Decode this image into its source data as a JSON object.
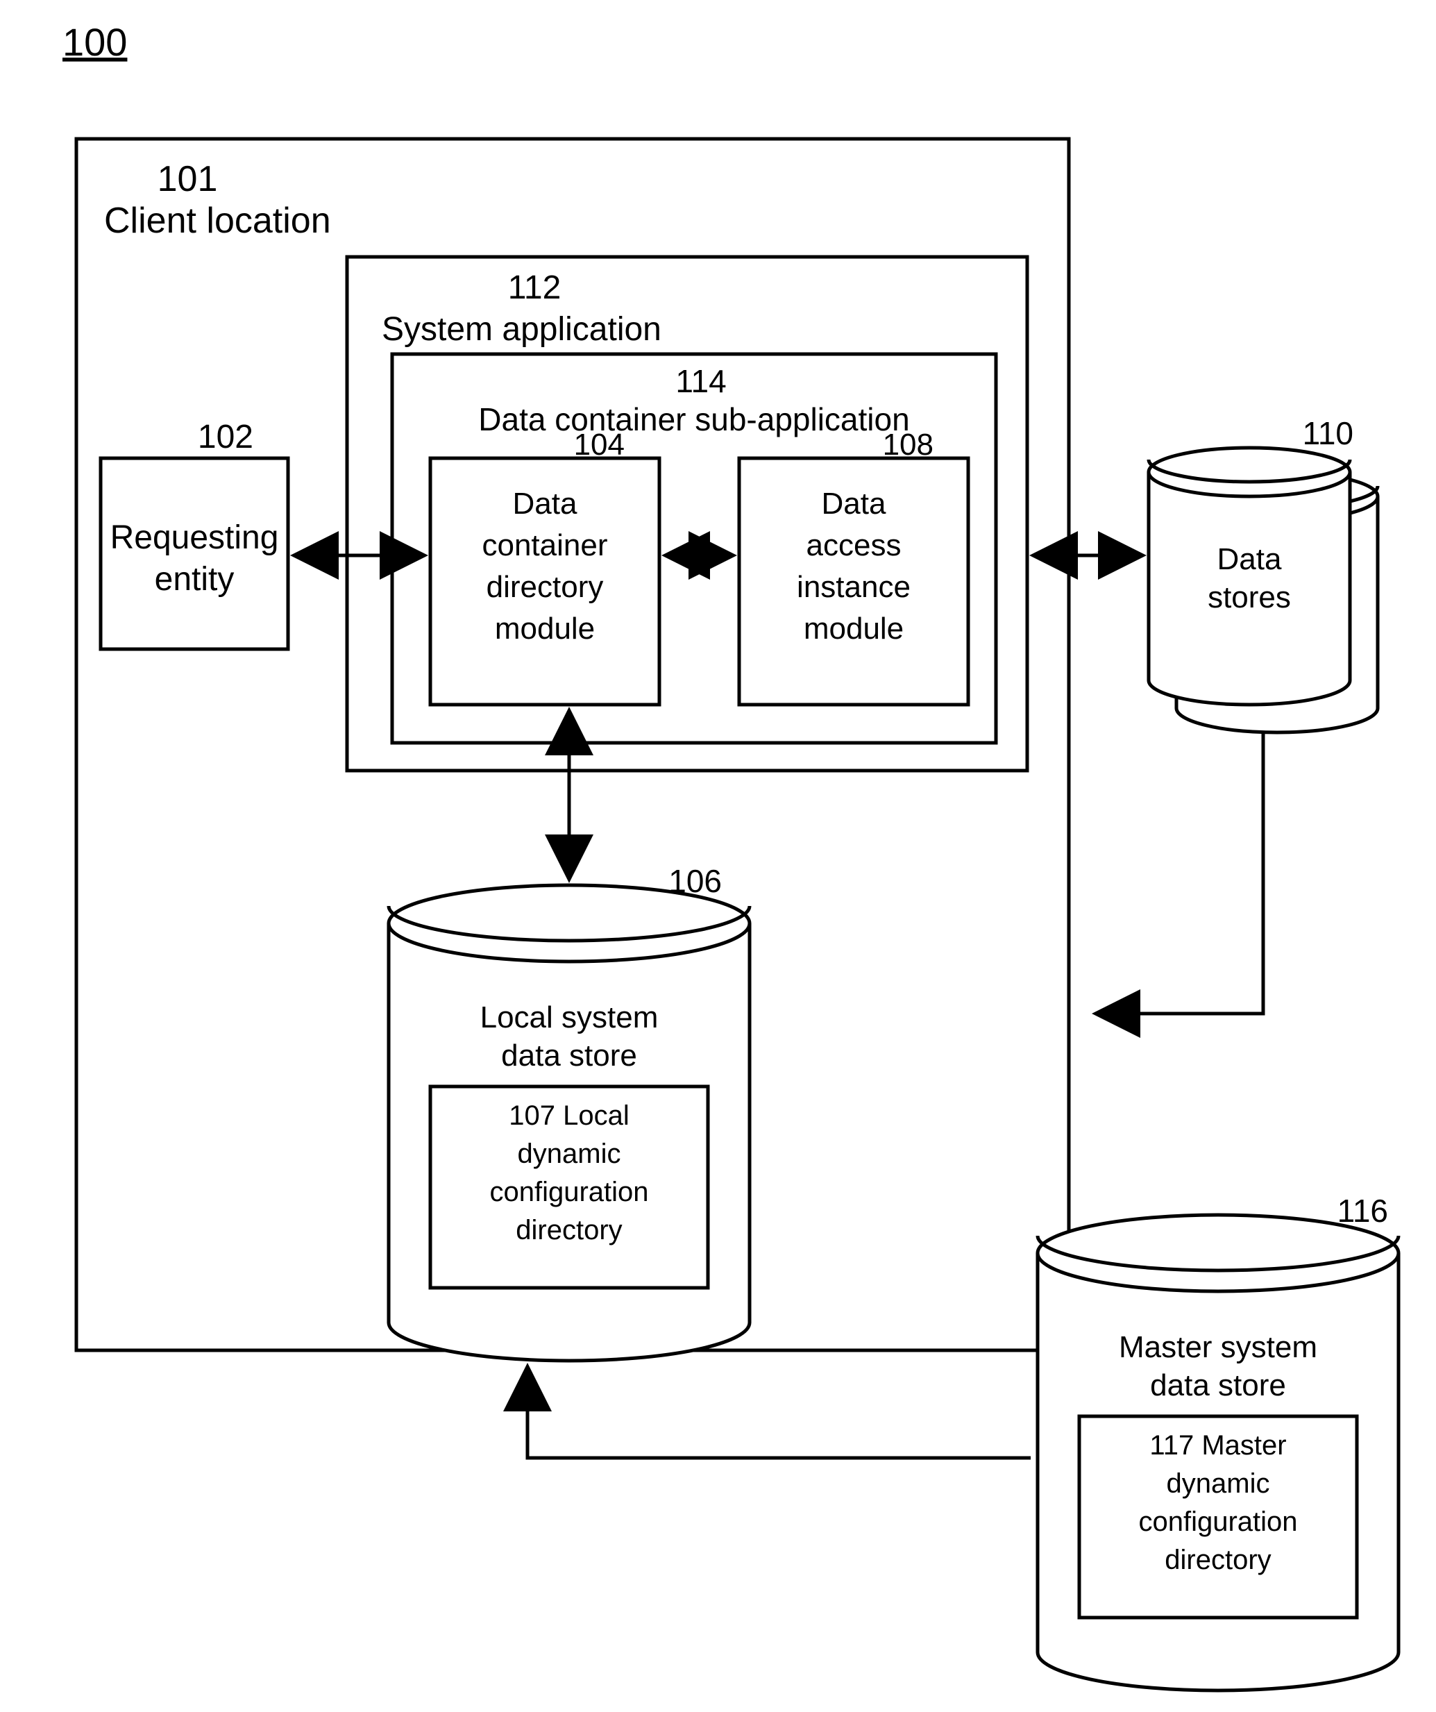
{
  "figure_label": "100",
  "client_location": {
    "ref": "101",
    "label": "Client location"
  },
  "requesting_entity": {
    "ref": "102",
    "label_l1": "Requesting",
    "label_l2": "entity"
  },
  "system_application": {
    "ref": "112",
    "label": "System application"
  },
  "data_container_sub_app": {
    "ref": "114",
    "label": "Data container sub-application"
  },
  "dcdm": {
    "ref": "104",
    "l1": "Data",
    "l2": "container",
    "l3": "directory",
    "l4": "module"
  },
  "daim": {
    "ref": "108",
    "l1": "Data",
    "l2": "access",
    "l3": "instance",
    "l4": "module"
  },
  "local_store": {
    "ref": "106",
    "title_l1": "Local system",
    "title_l2": "data store",
    "inner_ref": "107",
    "inner_l1": "Local",
    "inner_l2": "dynamic",
    "inner_l3": "configuration",
    "inner_l4": "directory"
  },
  "data_stores": {
    "ref": "110",
    "l1": "Data",
    "l2": "stores"
  },
  "master_store": {
    "ref": "116",
    "title_l1": "Master system",
    "title_l2": "data store",
    "inner_ref": "117",
    "inner_l1": "Master",
    "inner_l2": "dynamic",
    "inner_l3": "configuration",
    "inner_l4": "directory"
  }
}
